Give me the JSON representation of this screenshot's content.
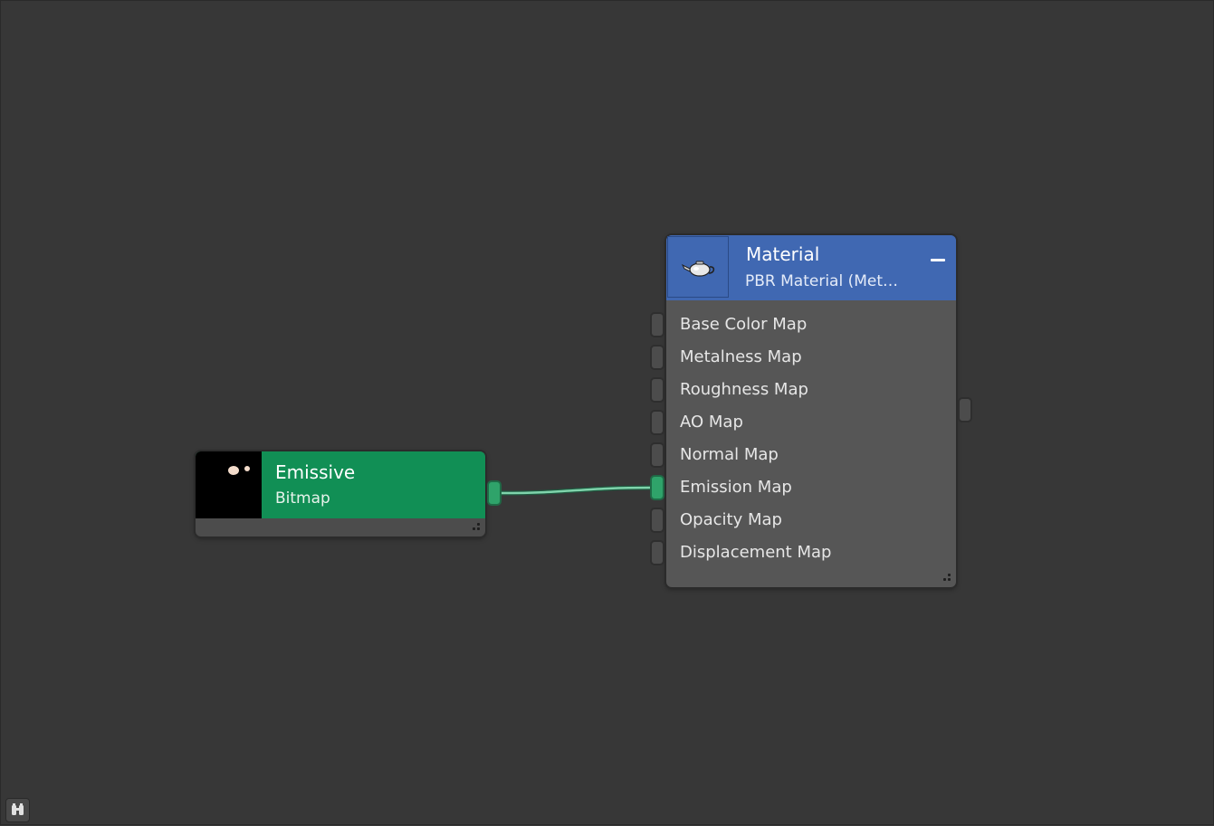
{
  "nodes": {
    "bitmap": {
      "title": "Emissive",
      "subtitle": "Bitmap",
      "header_color": "#118f55",
      "thumbnail": "emissive-texture-thumbnail"
    },
    "material": {
      "title": "Material",
      "subtitle": "PBR Material (Met…",
      "header_color": "#4068b2",
      "icon": "teapot-icon",
      "collapse_icon": "minus-icon",
      "slots": [
        {
          "label": "Base Color Map",
          "connected": false
        },
        {
          "label": "Metalness Map",
          "connected": false
        },
        {
          "label": "Roughness Map",
          "connected": false
        },
        {
          "label": "AO Map",
          "connected": false
        },
        {
          "label": "Normal Map",
          "connected": false
        },
        {
          "label": "Emission Map",
          "connected": true
        },
        {
          "label": "Opacity Map",
          "connected": false
        },
        {
          "label": "Displacement Map",
          "connected": false
        }
      ]
    }
  },
  "connections": [
    {
      "from": "bitmap.output",
      "to": "material.Emission Map",
      "color": "#6fc9a0"
    }
  ],
  "toolbar": {
    "find_icon": "binoculars-icon"
  },
  "colors": {
    "canvas": "#373737",
    "port_connected": "#2fa36a",
    "port_idle": "#4c4c4c"
  }
}
